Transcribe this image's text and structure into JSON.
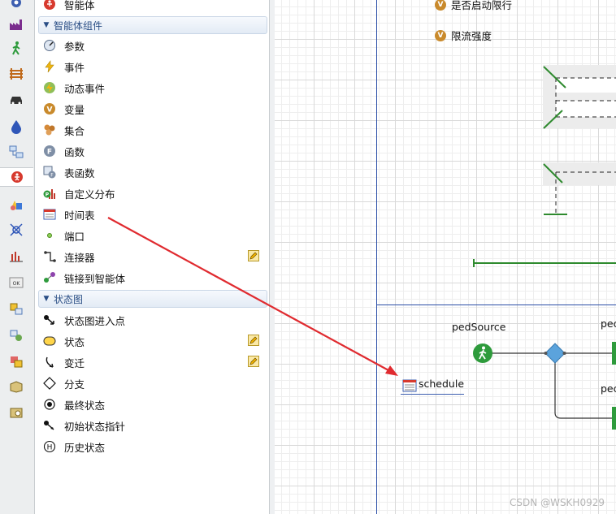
{
  "palette": {
    "top_item": {
      "label": "智能体",
      "icon": "agent-icon"
    },
    "sections": [
      {
        "title": "智能体组件",
        "items": [
          {
            "label": "参数",
            "icon": "parameter-icon"
          },
          {
            "label": "事件",
            "icon": "event-icon"
          },
          {
            "label": "动态事件",
            "icon": "dynamic-event-icon"
          },
          {
            "label": "变量",
            "icon": "variable-icon"
          },
          {
            "label": "集合",
            "icon": "collection-icon"
          },
          {
            "label": "函数",
            "icon": "function-icon"
          },
          {
            "label": "表函数",
            "icon": "table-function-icon"
          },
          {
            "label": "自定义分布",
            "icon": "custom-distribution-icon"
          },
          {
            "label": "时间表",
            "icon": "schedule-icon"
          },
          {
            "label": "端口",
            "icon": "port-icon"
          },
          {
            "label": "连接器",
            "icon": "connector-icon",
            "editable": true
          },
          {
            "label": "链接到智能体",
            "icon": "link-to-agent-icon"
          }
        ]
      },
      {
        "title": "状态图",
        "items": [
          {
            "label": "状态图进入点",
            "icon": "statechart-entry-icon"
          },
          {
            "label": "状态",
            "icon": "state-icon",
            "editable": true
          },
          {
            "label": "变迁",
            "icon": "transition-icon",
            "editable": true
          },
          {
            "label": "分支",
            "icon": "branch-icon"
          },
          {
            "label": "最终状态",
            "icon": "final-state-icon"
          },
          {
            "label": "初始状态指针",
            "icon": "initial-state-pointer-icon"
          },
          {
            "label": "历史状态",
            "icon": "history-state-icon"
          }
        ]
      }
    ]
  },
  "toolstrip": {
    "icons": [
      "agent-tool-icon",
      "process-modeling-icon",
      "pedestrian-library-icon",
      "rail-library-icon",
      "road-traffic-icon",
      "fluid-library-icon",
      "material-handling-icon",
      "agent-palette-icon",
      "presentation-icon",
      "space-markup-icon",
      "analysis-icon",
      "controls-icon",
      "connectivity-icon",
      "system-dynamics-icon",
      "pictures-icon",
      "3d-objects-icon",
      "marketplace-icon"
    ],
    "selected": "agent-palette-icon"
  },
  "canvas": {
    "variables": [
      {
        "label": "是否启动限行",
        "icon": "variable-icon"
      },
      {
        "label": "限流强度",
        "icon": "variable-icon"
      }
    ],
    "schedule_label": "schedule",
    "ped_source_label": "pedSource",
    "ped_partial_1": "pec",
    "ped_partial_2": "pec",
    "colors": {
      "link_line": "#2b4ea6",
      "ped_green": "#2e9b3c",
      "arrow": "#e02b30",
      "wall": "#2e8a2e"
    }
  },
  "watermark": "CSDN @WSKH0929"
}
